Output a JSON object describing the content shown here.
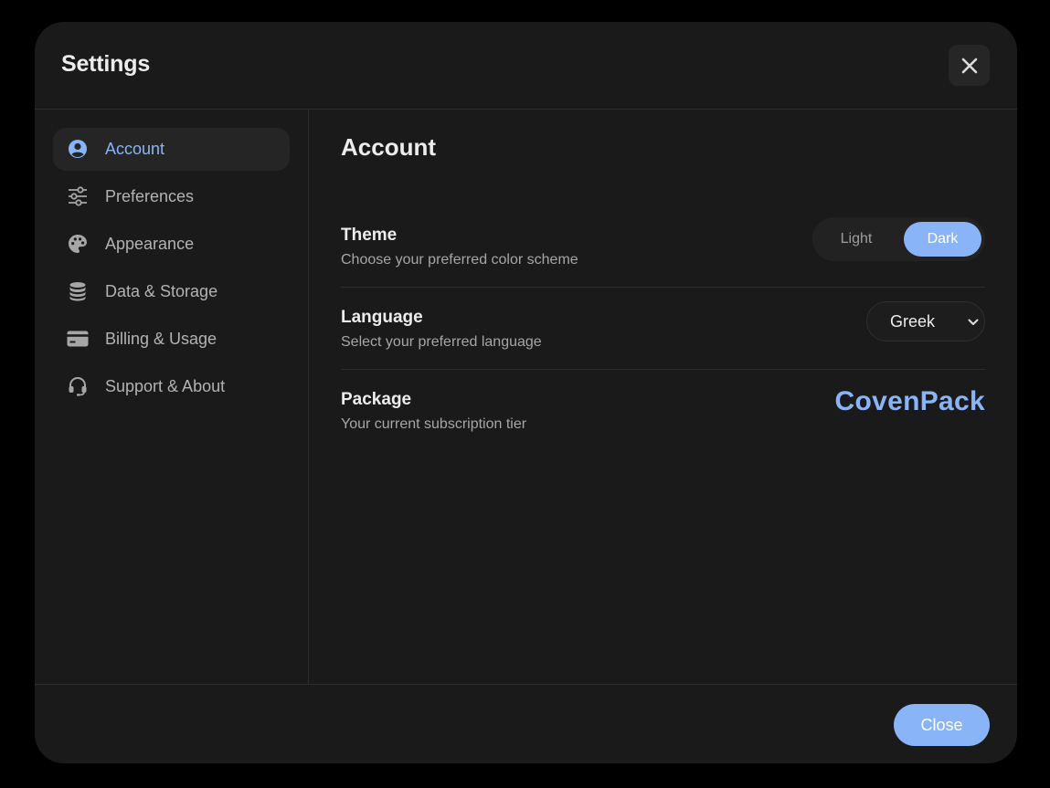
{
  "header": {
    "title": "Settings",
    "close_icon": "close-icon"
  },
  "sidebar": {
    "items": [
      {
        "label": "Account",
        "icon": "account-circle-icon",
        "active": true
      },
      {
        "label": "Preferences",
        "icon": "sliders-icon",
        "active": false
      },
      {
        "label": "Appearance",
        "icon": "palette-icon",
        "active": false
      },
      {
        "label": "Data & Storage",
        "icon": "database-icon",
        "active": false
      },
      {
        "label": "Billing & Usage",
        "icon": "credit-card-icon",
        "active": false
      },
      {
        "label": "Support & About",
        "icon": "headset-icon",
        "active": false
      }
    ]
  },
  "main": {
    "title": "Account",
    "theme": {
      "label": "Theme",
      "description": "Choose your preferred color scheme",
      "options": [
        "Light",
        "Dark"
      ],
      "selected": "Dark"
    },
    "language": {
      "label": "Language",
      "description": "Select your preferred language",
      "value": "Greek"
    },
    "package": {
      "label": "Package",
      "description": "Your current subscription tier",
      "value": "CovenPack"
    }
  },
  "footer": {
    "close_label": "Close"
  },
  "colors": {
    "accent": "#8ab4f8",
    "background": "#1a1a1a",
    "overlay": "#000000"
  }
}
